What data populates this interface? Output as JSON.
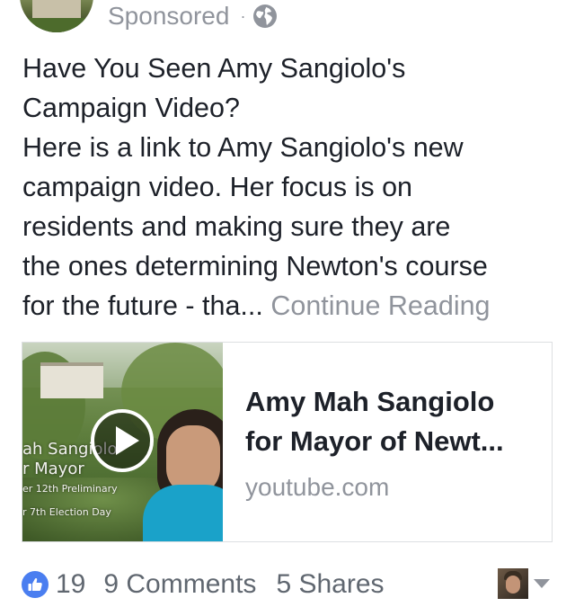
{
  "header": {
    "sponsored_label": "Sponsored",
    "separator": "·",
    "audience_icon": "globe-icon"
  },
  "post": {
    "lines": [
      "Have You Seen Amy Sangiolo's",
      "Campaign Video?",
      "Here is a link to Amy Sangiolo's new",
      "campaign video.  Her focus is on",
      "residents and making sure they are",
      "the ones determining Newton's course",
      "for the future - tha... "
    ],
    "continue_label": "Continue Reading"
  },
  "link_card": {
    "thumbnail_text": {
      "line1": "ah Sangiolo",
      "line2": "r Mayor",
      "line3": "er 12th Preliminary",
      "line4": "r 7th Election Day"
    },
    "play_icon": "play-icon",
    "title_line1": "Amy Mah Sangiolo",
    "title_line2": "for Mayor of Newt...",
    "domain": "youtube.com"
  },
  "footer": {
    "like_icon": "thumbs-up-icon",
    "like_count": "19",
    "comments_label": "9 Comments",
    "shares_label": "5 Shares",
    "dropdown_icon": "caret-down-icon"
  },
  "colors": {
    "text": "#1d2129",
    "muted": "#90949c",
    "like_blue": "#4a7ef0",
    "card_border": "#dddfe2"
  }
}
